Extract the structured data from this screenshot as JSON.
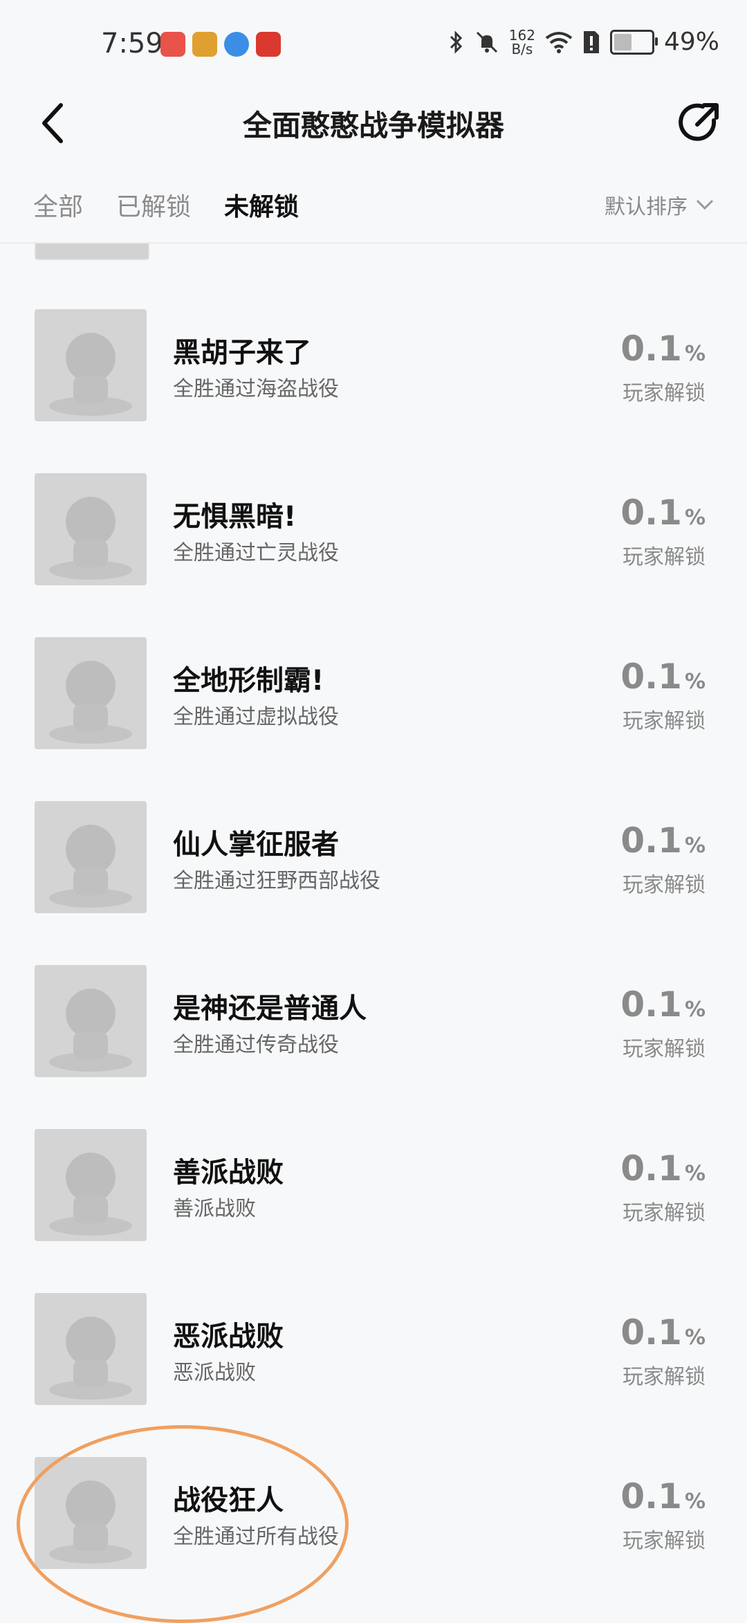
{
  "status_bar": {
    "time": "7:59",
    "net_speed_value": "162",
    "net_speed_unit": "B/s",
    "battery": "49%",
    "battery_level": 0.49
  },
  "header": {
    "title": "全面憨憨战争模拟器"
  },
  "tabs": [
    {
      "label": "全部"
    },
    {
      "label": "已解锁"
    },
    {
      "label": "未解锁"
    }
  ],
  "sort": {
    "label": "默认排序"
  },
  "unlock_label": "玩家解锁",
  "items": [
    {
      "title": "黑胡子来了",
      "desc": "全胜通过海盗战役",
      "percent": "0.1",
      "unit": "%"
    },
    {
      "title": "无惧黑暗!",
      "desc": "全胜通过亡灵战役",
      "percent": "0.1",
      "unit": "%"
    },
    {
      "title": "全地形制霸!",
      "desc": "全胜通过虚拟战役",
      "percent": "0.1",
      "unit": "%"
    },
    {
      "title": "仙人掌征服者",
      "desc": "全胜通过狂野西部战役",
      "percent": "0.1",
      "unit": "%"
    },
    {
      "title": "是神还是普通人",
      "desc": "全胜通过传奇战役",
      "percent": "0.1",
      "unit": "%"
    },
    {
      "title": "善派战败",
      "desc": "善派战败",
      "percent": "0.1",
      "unit": "%"
    },
    {
      "title": "恶派战败",
      "desc": "恶派战败",
      "percent": "0.1",
      "unit": "%"
    },
    {
      "title": "战役狂人",
      "desc": "全胜通过所有战役",
      "percent": "0.1",
      "unit": "%"
    }
  ]
}
